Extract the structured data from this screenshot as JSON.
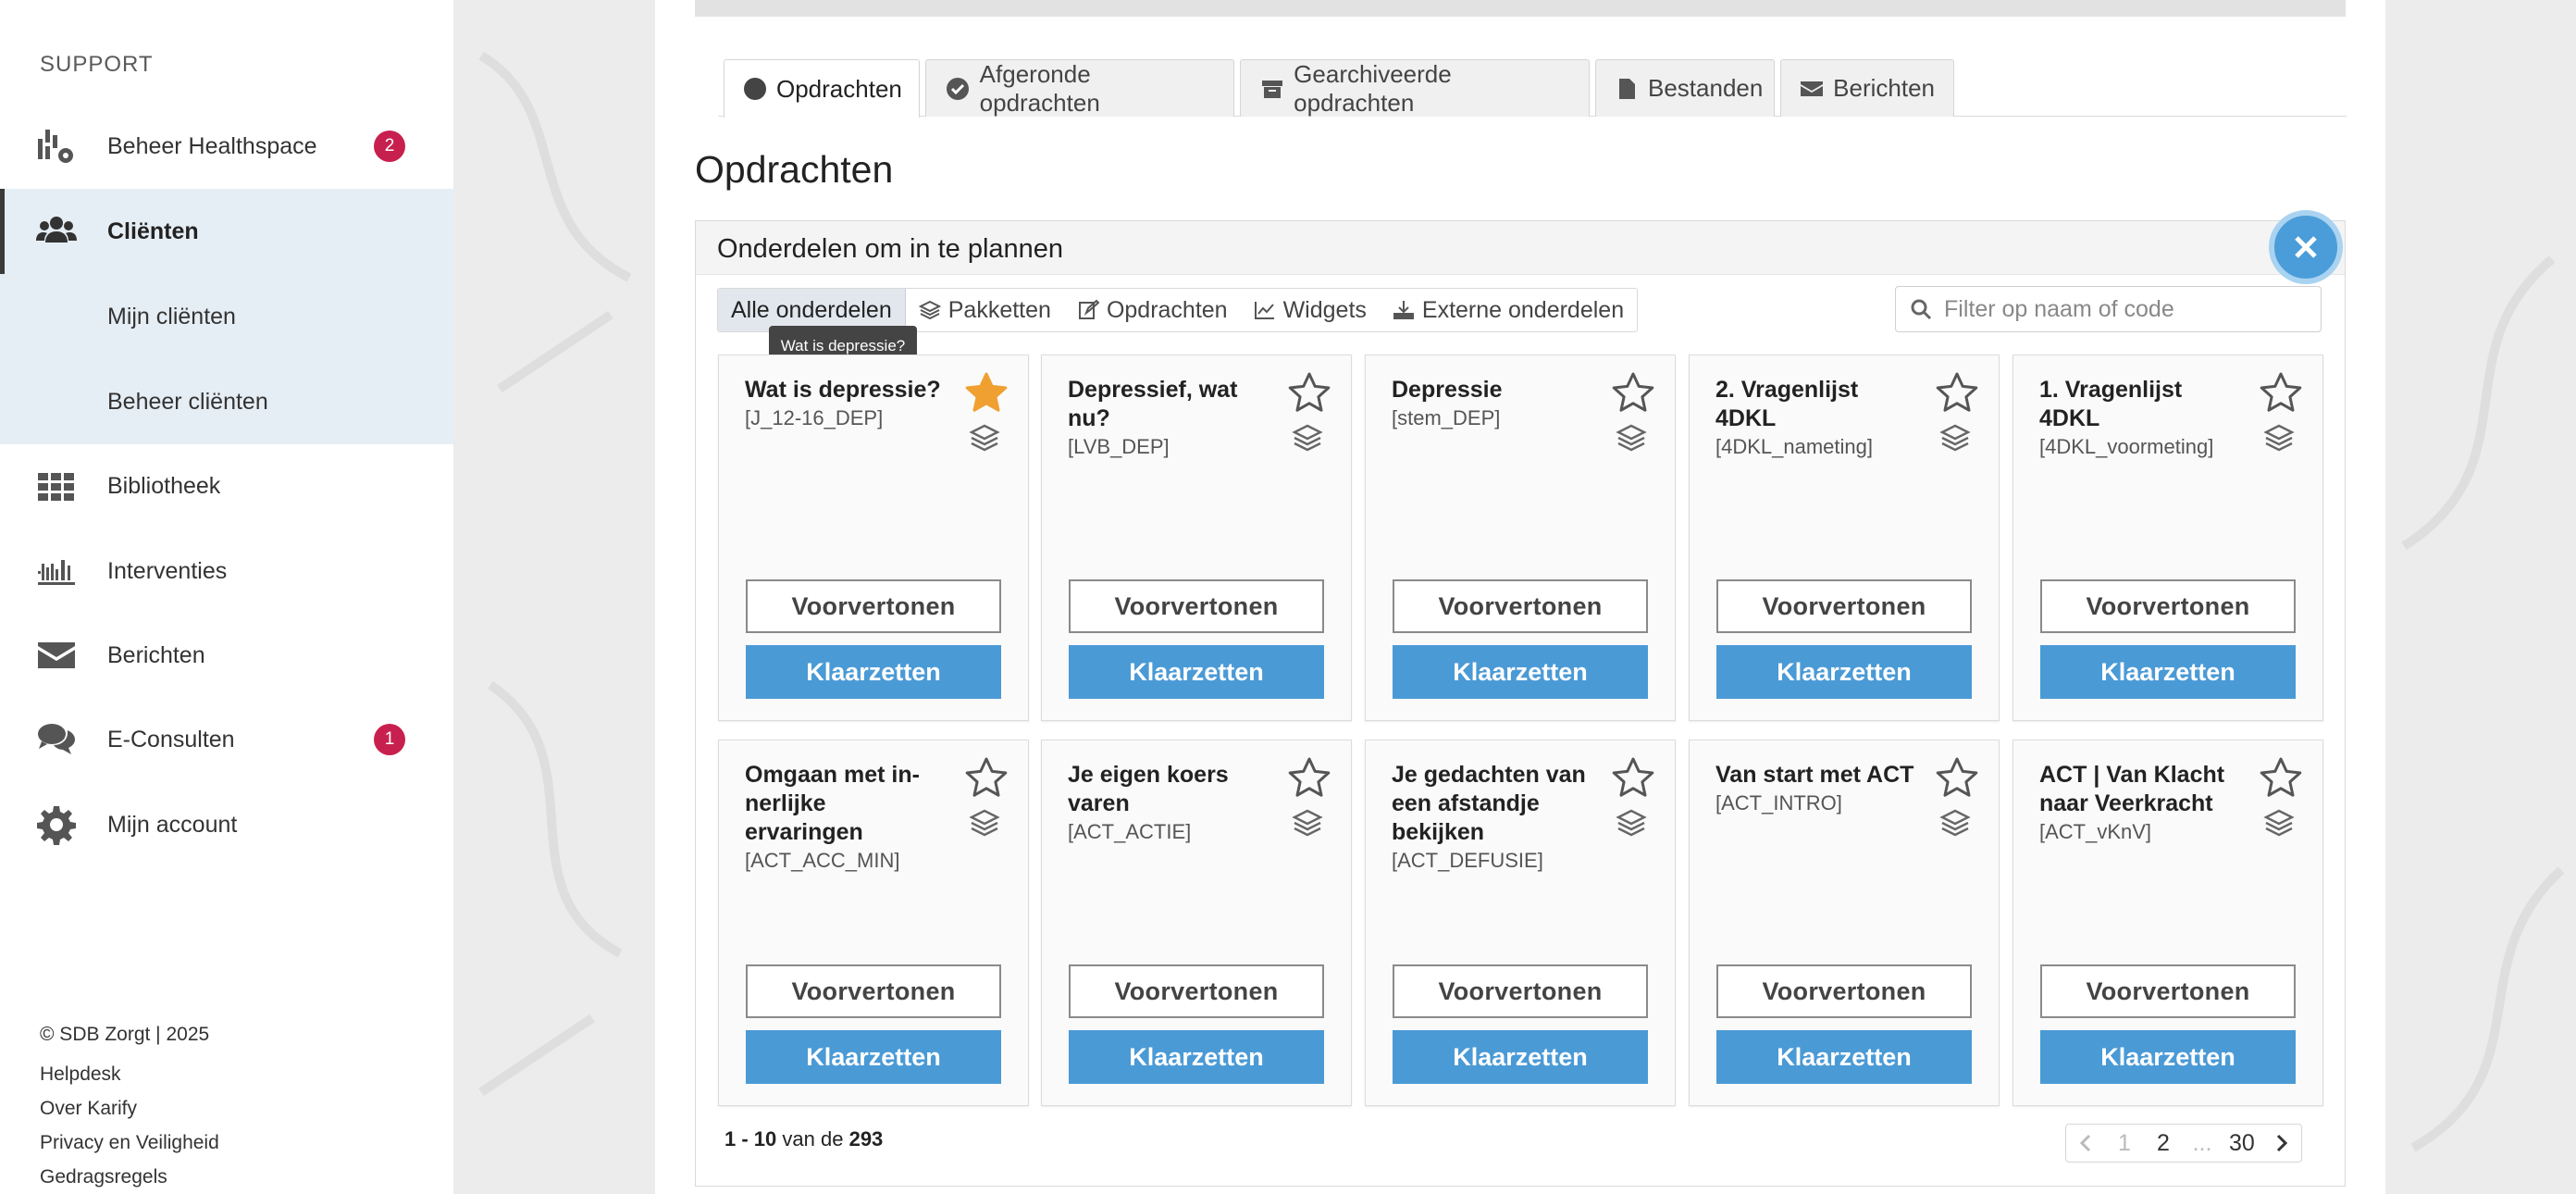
{
  "sidebar": {
    "heading": "SUPPORT",
    "items": [
      {
        "label": "Beheer Healthspace",
        "icon": "healthspace-icon",
        "badge": "2"
      },
      {
        "label": "Cliënten",
        "icon": "users-icon",
        "active": true
      },
      {
        "label": "Bibliotheek",
        "icon": "grid-icon"
      },
      {
        "label": "Interventies",
        "icon": "shelf-icon"
      },
      {
        "label": "Berichten",
        "icon": "envelope-icon"
      },
      {
        "label": "E-Consulten",
        "icon": "chat-icon",
        "badge": "1"
      },
      {
        "label": "Mijn account",
        "icon": "gear-icon"
      }
    ],
    "sub_items": [
      "Mijn cliënten",
      "Beheer cliënten"
    ],
    "footer": [
      "© SDB Zorgt | 2025",
      "Helpdesk",
      "Over Karify",
      "Privacy en Veiligheid",
      "Gedragsregels"
    ]
  },
  "tabs": [
    {
      "label": "Opdrachten",
      "icon": "circle-icon",
      "active": true
    },
    {
      "label": "Afgeronde opdrachten",
      "icon": "check-circle-icon"
    },
    {
      "label": "Gearchiveerde opdrachten",
      "icon": "archive-icon"
    },
    {
      "label": "Bestanden",
      "icon": "file-icon"
    },
    {
      "label": "Berichten",
      "icon": "envelope-icon"
    }
  ],
  "page_title": "Opdrachten",
  "panel": {
    "title": "Onderdelen om in te plannen",
    "filters": [
      {
        "label": "Alle onderdelen",
        "active": true
      },
      {
        "label": "Pakketten",
        "icon": "layers-icon"
      },
      {
        "label": "Opdrachten",
        "icon": "edit-icon"
      },
      {
        "label": "Widgets",
        "icon": "chart-icon"
      },
      {
        "label": "Externe onderdelen",
        "icon": "download-icon"
      }
    ],
    "search_placeholder": "Filter op naam of code",
    "tooltip": "Wat is depressie?",
    "cards": [
      {
        "title": "Wat is depressie?",
        "code": "[J_12-16_DEP]",
        "starred": true
      },
      {
        "title": "Depressief, wat nu?",
        "code": "[LVB_DEP]",
        "starred": false
      },
      {
        "title": "Depressie",
        "code": "[stem_DEP]",
        "starred": false
      },
      {
        "title": "2. Vragenlijst 4DKL",
        "code": "[4DKL_nameting]",
        "starred": false
      },
      {
        "title": "1. Vragenlijst 4DKL",
        "code": "[4DKL_voormeting]",
        "starred": false
      },
      {
        "title": "Omgaan met in­nerlijke ervaringen",
        "code": "[ACT_ACC_MIN]",
        "starred": false
      },
      {
        "title": "Je eigen koers varen",
        "code": "[ACT_ACTIE]",
        "starred": false
      },
      {
        "title": "Je gedachten van een afstand­je bekijken",
        "code": "[ACT_DEFUSIE]",
        "starred": false
      },
      {
        "title": "Van start met ACT",
        "code": "[ACT_INTRO]",
        "starred": false
      },
      {
        "title": "ACT | Van Klacht naar Veerkracht",
        "code": "[ACT_vKnV]",
        "starred": false
      }
    ],
    "preview_label": "Voorvertonen",
    "ready_label": "Klaarzetten",
    "count": {
      "range": "1 - 10",
      "of": "van de",
      "total": "293"
    },
    "pagination": {
      "pages": [
        "1",
        "2",
        "...",
        "30"
      ],
      "current": "1"
    }
  },
  "colors": {
    "primary": "#4a9ad6",
    "badge": "#c8204e",
    "star_active": "#f0a030",
    "active_bg": "#e6eef5"
  }
}
